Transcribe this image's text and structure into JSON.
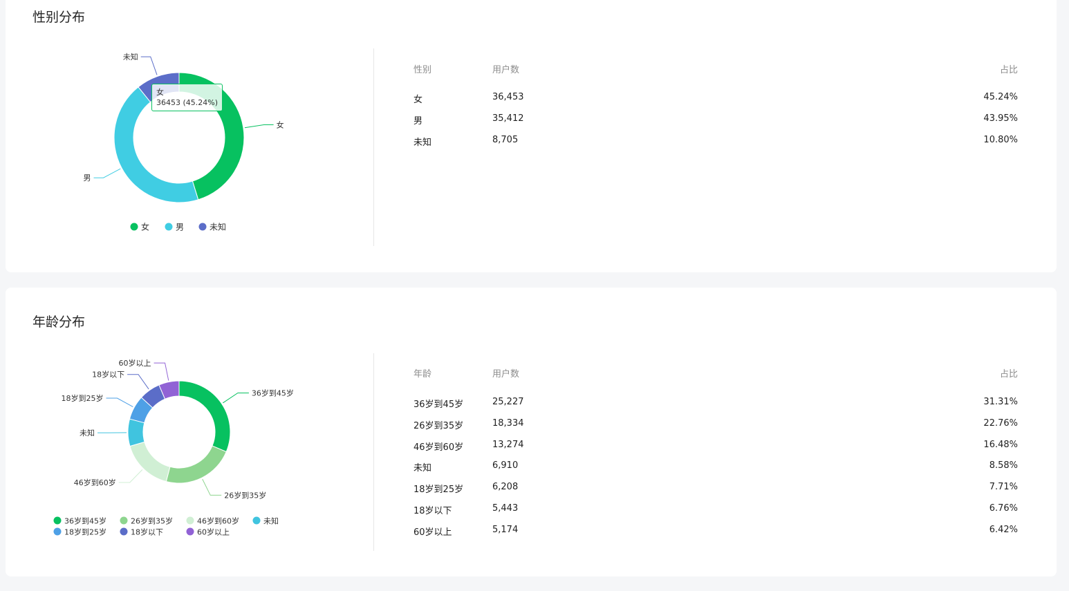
{
  "gender": {
    "title": "性别分布",
    "table": {
      "headers": [
        "性别",
        "用户数",
        "占比"
      ],
      "rows": [
        [
          "女",
          "36,453",
          "45.24%"
        ],
        [
          "男",
          "35,412",
          "43.95%"
        ],
        [
          "未知",
          "8,705",
          "10.80%"
        ]
      ]
    },
    "tooltip": {
      "name": "女",
      "value": "36453 (45.24%)"
    },
    "chart_data": {
      "type": "pie",
      "categories": [
        "女",
        "男",
        "未知"
      ],
      "values": [
        36453,
        35412,
        8705
      ],
      "colors": [
        "#07c160",
        "#40cde3",
        "#5b6dc8"
      ],
      "legend": [
        "女",
        "男",
        "未知"
      ],
      "legend_position": "bottom"
    }
  },
  "age": {
    "title": "年龄分布",
    "table": {
      "headers": [
        "年龄",
        "用户数",
        "占比"
      ],
      "rows": [
        [
          "36岁到45岁",
          "25,227",
          "31.31%"
        ],
        [
          "26岁到35岁",
          "18,334",
          "22.76%"
        ],
        [
          "46岁到60岁",
          "13,274",
          "16.48%"
        ],
        [
          "未知",
          "6,910",
          "8.58%"
        ],
        [
          "18岁到25岁",
          "6,208",
          "7.71%"
        ],
        [
          "18岁以下",
          "5,443",
          "6.76%"
        ],
        [
          "60岁以上",
          "5,174",
          "6.42%"
        ]
      ]
    },
    "chart_data": {
      "type": "pie",
      "categories": [
        "36岁到45岁",
        "26岁到35岁",
        "46岁到60岁",
        "未知",
        "18岁到25岁",
        "18岁以下",
        "60岁以上"
      ],
      "values": [
        25227,
        18334,
        13274,
        6910,
        6208,
        5443,
        5174
      ],
      "colors": [
        "#07c160",
        "#8ed58f",
        "#d0efd4",
        "#40c4df",
        "#4ea0e6",
        "#5b6dc8",
        "#9162d5"
      ],
      "legend": [
        "36岁到45岁",
        "26岁到35岁",
        "46岁到60岁",
        "未知",
        "18岁到25岁",
        "18岁以下",
        "60岁以上"
      ],
      "legend_position": "bottom"
    }
  }
}
